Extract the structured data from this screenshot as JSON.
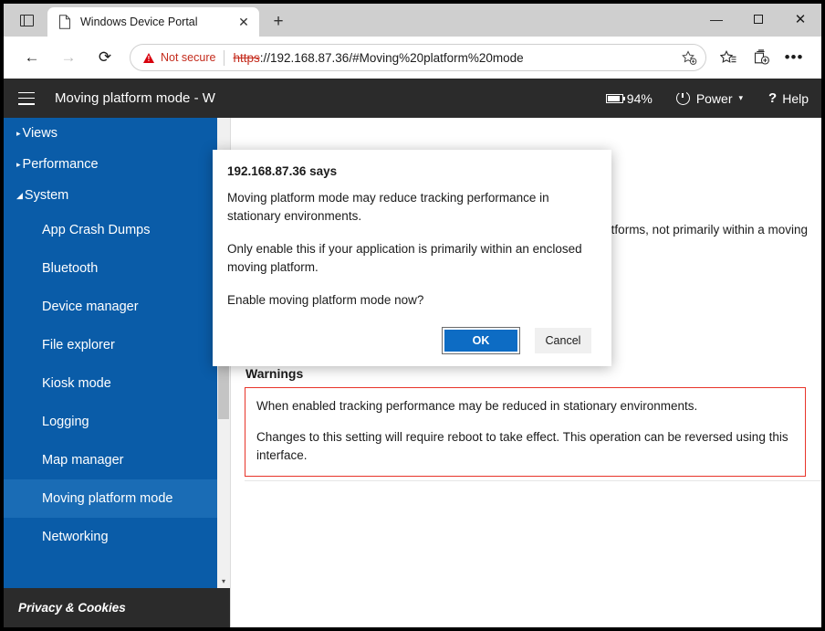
{
  "browser": {
    "tab": {
      "title": "Windows Device Portal",
      "favicon_icon": "page-icon",
      "close_icon": "close-icon"
    },
    "tab_search_icon": "tab-search-icon",
    "new_tab_label": "+",
    "window_controls": {
      "minimize": "minimize-icon",
      "maximize": "maximize-icon",
      "close": "close-icon"
    },
    "toolbar": {
      "back_glyph": "←",
      "forward_glyph": "→",
      "reload_glyph": "⟳",
      "security_label": "Not secure",
      "security_icon": "warning-triangle-icon",
      "url_scheme": "https",
      "url_rest": "://192.168.87.36/#Moving%20platform%20mode",
      "url_full": "https://192.168.87.36/#Moving%20platform%20mode",
      "favorite_icon": "star-plus-icon",
      "favorites_icon": "favorites-list-icon",
      "collections_icon": "collections-icon",
      "settings_glyph": "•••"
    }
  },
  "app": {
    "header": {
      "menu_icon": "hamburger-menu-icon",
      "title": "Moving platform mode - W",
      "battery_icon": "battery-icon",
      "battery_percent": "94%",
      "power_icon": "power-icon",
      "power_label": "Power",
      "power_caret": "▾",
      "help_glyph": "?",
      "help_label": "Help"
    },
    "sidebar": {
      "groups": [
        {
          "label": "Views",
          "arrow": "▸",
          "expanded": false
        },
        {
          "label": "Performance",
          "arrow": "▸",
          "expanded": false
        },
        {
          "label": "System",
          "arrow": "◢",
          "expanded": true
        }
      ],
      "items": [
        {
          "label": "App Crash Dumps",
          "selected": false
        },
        {
          "label": "Bluetooth",
          "selected": false
        },
        {
          "label": "Device manager",
          "selected": false
        },
        {
          "label": "File explorer",
          "selected": false
        },
        {
          "label": "Kiosk mode",
          "selected": false
        },
        {
          "label": "Logging",
          "selected": false
        },
        {
          "label": "Map manager",
          "selected": false
        },
        {
          "label": "Moving platform mode",
          "selected": true
        },
        {
          "label": "Networking",
          "selected": false
        }
      ],
      "scroll_down_glyph": "▾",
      "privacy_label": "Privacy & Cookies"
    },
    "content": {
      "intro_text": "ed for use on moving platforms, not primarily within a moving",
      "warnings_heading": "Warnings",
      "warnings": [
        "When enabled tracking performance may be reduced in stationary environments.",
        "Changes to this setting will require reboot to take effect. This operation can be reversed using this interface."
      ]
    }
  },
  "dialog": {
    "title": "192.168.87.36 says",
    "paragraphs": [
      "Moving platform mode may reduce tracking performance in stationary environments.",
      " Only enable this if your application is primarily within an enclosed moving platform.",
      "Enable moving platform mode now?"
    ],
    "ok_label": "OK",
    "cancel_label": "Cancel"
  },
  "colors": {
    "sidebar_blue": "#0a5ca8",
    "sidebar_selected": "#1a6cb5",
    "header_dark": "#2b2b2b",
    "warning_red": "#e8342a",
    "not_secure_red": "#c42b1c",
    "button_blue": "#0d6cc4"
  }
}
